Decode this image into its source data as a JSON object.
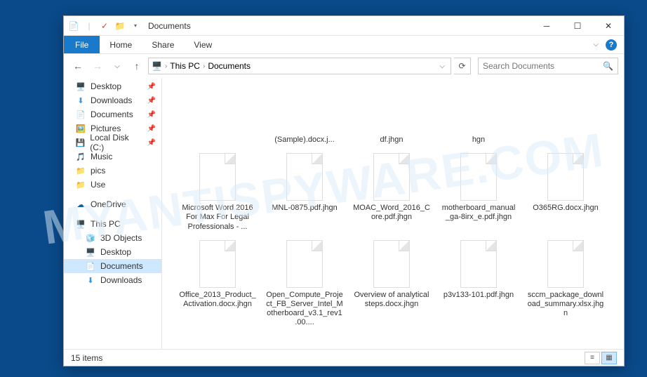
{
  "watermark": "MYANTISPYWARE.COM",
  "titlebar": {
    "title": "Documents"
  },
  "ribbon": {
    "file": "File",
    "tabs": [
      "Home",
      "Share",
      "View"
    ]
  },
  "breadcrumb": {
    "parts": [
      "This PC",
      "Documents"
    ],
    "refresh_tip": "Refresh"
  },
  "search": {
    "placeholder": "Search Documents"
  },
  "sidebar": {
    "quick": [
      {
        "label": "Desktop",
        "icon": "desktop",
        "pinned": true
      },
      {
        "label": "Downloads",
        "icon": "downloads",
        "pinned": true
      },
      {
        "label": "Documents",
        "icon": "doc",
        "pinned": true
      },
      {
        "label": "Pictures",
        "icon": "pic",
        "pinned": true
      },
      {
        "label": "Local Disk (C:)",
        "icon": "disk",
        "pinned": true
      },
      {
        "label": "Music",
        "icon": "music",
        "pinned": false
      },
      {
        "label": "pics",
        "icon": "folder",
        "pinned": false
      },
      {
        "label": "Use",
        "icon": "folder",
        "pinned": false
      }
    ],
    "onedrive": "OneDrive",
    "thispc": "This PC",
    "thispc_items": [
      {
        "label": "3D Objects",
        "icon": "3d"
      },
      {
        "label": "Desktop",
        "icon": "desktop"
      },
      {
        "label": "Documents",
        "icon": "doc",
        "selected": true
      },
      {
        "label": "Downloads",
        "icon": "downloads"
      }
    ]
  },
  "files": {
    "row1": [
      {
        "label": "",
        "hidden": true
      },
      {
        "label": "(Sample).docx.j...",
        "thumbhidden": true
      },
      {
        "label": "df.jhgn",
        "thumbhidden": true
      },
      {
        "label": "hgn",
        "thumbhidden": true
      },
      {
        "label": "",
        "hidden": true
      }
    ],
    "row2": [
      {
        "label": "Microsoft Word 2016 For Max For Legal Professionals - ..."
      },
      {
        "label": "MNL-0875.pdf.jhgn"
      },
      {
        "label": "MOAC_Word_2016_Core.pdf.jhgn"
      },
      {
        "label": "motherboard_manual_ga-8irx_e.pdf.jhgn"
      },
      {
        "label": "O365RG.docx.jhgn"
      }
    ],
    "row3": [
      {
        "label": "Office_2013_Product_Activation.docx.jhgn"
      },
      {
        "label": "Open_Compute_Project_FB_Server_Intel_Motherboard_v3.1_rev1.00...."
      },
      {
        "label": "Overview of analytical steps.docx.jhgn"
      },
      {
        "label": "p3v133-101.pdf.jhgn"
      },
      {
        "label": "sccm_package_download_summary.xlsx.jhgn"
      }
    ]
  },
  "status": {
    "count": "15 items"
  }
}
